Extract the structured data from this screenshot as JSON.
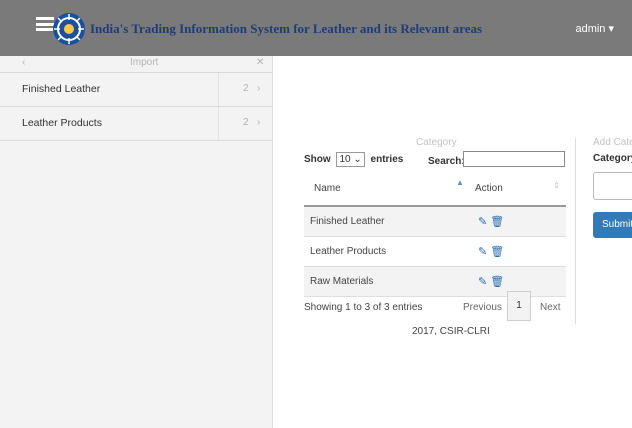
{
  "header": {
    "title": "India's Trading Information System for Leather and its Relevant areas",
    "user_menu": "admin ▾"
  },
  "sidebar": {
    "back": "‹",
    "heading": "Import",
    "close": "✕",
    "items": [
      {
        "label": "Finished Leather",
        "count": "2",
        "chevron": "›"
      },
      {
        "label": "Leather Products",
        "count": "2",
        "chevron": "›"
      }
    ]
  },
  "category_panel": {
    "label": "Category",
    "show_prefix": "Show",
    "page_size": "10",
    "show_suffix": "entries",
    "search_label": "Search:",
    "columns": [
      "Name",
      "Action"
    ],
    "rows": [
      {
        "name": "Finished Leather"
      },
      {
        "name": "Leather Products"
      },
      {
        "name": "Raw Materials"
      }
    ],
    "info": "Showing 1 to 3 of 3 entries",
    "pagination": {
      "previous": "Previous",
      "current": "1",
      "next": "Next"
    }
  },
  "add_panel": {
    "label": "Add Cate",
    "field_label": "Category'",
    "submit": "Submit"
  },
  "footer": {
    "text": "2017, CSIR-CLRI"
  },
  "colors": {
    "topbar": "#7a7a7a",
    "title": "#1f3c78",
    "primary": "#337ab7"
  }
}
